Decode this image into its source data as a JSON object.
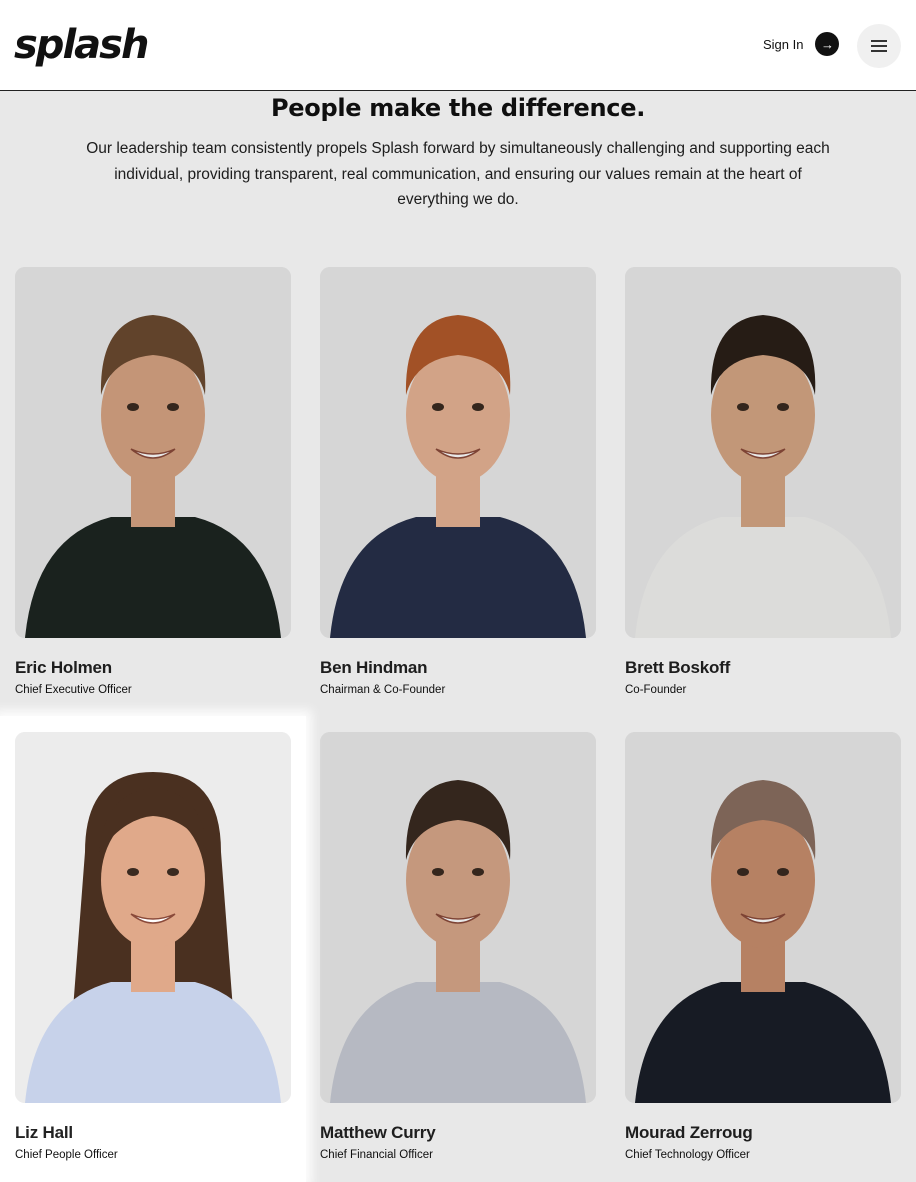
{
  "header": {
    "logo": "splash",
    "signin_label": "Sign In"
  },
  "intro": {
    "title": "People make the difference.",
    "body": "Our leadership team consistently propels Splash forward by simultaneously challenging and supporting each individual, providing transparent, real communication, and ensuring our values remain at the heart of everything we do."
  },
  "team": [
    {
      "name": "Eric Holmen",
      "role": "Chief Executive Officer",
      "shirt": "#1d2622",
      "hair": "#6b4a30",
      "skin": "#d8a483"
    },
    {
      "name": "Ben Hindman",
      "role": "Chairman & Co-Founder",
      "shirt": "#27304a",
      "hair": "#b25a2a",
      "skin": "#e7b495"
    },
    {
      "name": "Brett Boskoff",
      "role": "Co-Founder",
      "shirt": "#f2f2f0",
      "hair": "#2a1f18",
      "skin": "#d6a684"
    },
    {
      "name": "Liz Hall",
      "role": "Chief People Officer",
      "shirt": "#c7d2ea",
      "hair": "#4a3020",
      "skin": "#e0a98a"
    },
    {
      "name": "Matthew Curry",
      "role": "Chief Financial Officer",
      "shirt": "#c8ccd6",
      "hair": "#3a2a20",
      "skin": "#d9a88a"
    },
    {
      "name": "Mourad Zerroug",
      "role": "Chief Technology Officer",
      "shirt": "#1a1e28",
      "hair": "#8a6e60",
      "skin": "#c98e6d"
    }
  ]
}
